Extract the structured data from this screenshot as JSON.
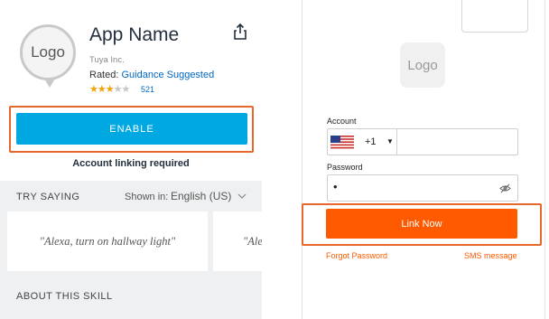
{
  "skill": {
    "logo_text": "Logo",
    "app_name": "App Name",
    "developer": "Tuya Inc.",
    "rated_prefix": "Rated:",
    "rating_label": "Guidance Suggested",
    "stars_filled": 3,
    "stars_total": 5,
    "review_count": "521",
    "enable_label": "ENABLE",
    "linking_note": "Account linking required",
    "try_saying_title": "TRY SAYING",
    "shown_in_label": "Shown in:",
    "language": "English (US)",
    "utterances": [
      "\"Alexa, turn on hallway light\"",
      "\"Ale"
    ],
    "about_title": "ABOUT THIS SKILL"
  },
  "login": {
    "logo_text": "Logo",
    "account_label": "Account",
    "country_code": "+1",
    "account_value": "",
    "password_label": "Password",
    "password_value": "•",
    "link_now_label": "Link Now",
    "forgot_password": "Forgot Password",
    "sms_message": "SMS message"
  },
  "colors": {
    "enable_blue": "#00a8e1",
    "link_orange": "#ff5a00",
    "highlight_frame": "#e8682c",
    "link_blue": "#0066c0",
    "star_gold": "#f0a30a"
  },
  "icons": [
    "share-icon",
    "chevron-down-icon",
    "us-flag-icon",
    "caret-down-icon",
    "eye-slash-icon"
  ]
}
